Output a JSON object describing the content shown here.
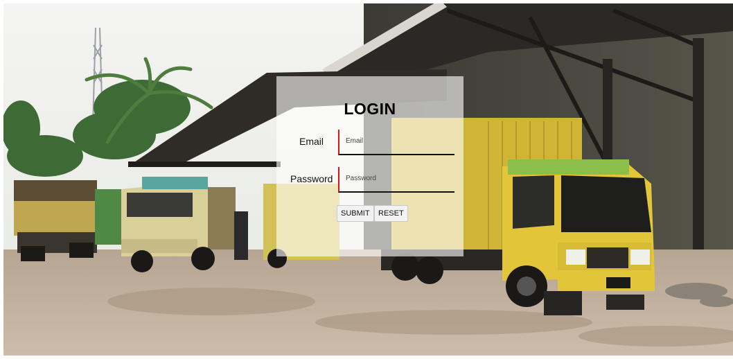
{
  "login": {
    "title": "LOGIN",
    "email_label": "Email",
    "email_placeholder": "Email",
    "email_value": "",
    "password_label": "Password",
    "password_placeholder": "Password",
    "password_value": "",
    "submit_label": "SUBMIT",
    "reset_label": "RESET"
  },
  "colors": {
    "accent_line": "#e01313",
    "truck_yellow": "#e3c53a"
  }
}
